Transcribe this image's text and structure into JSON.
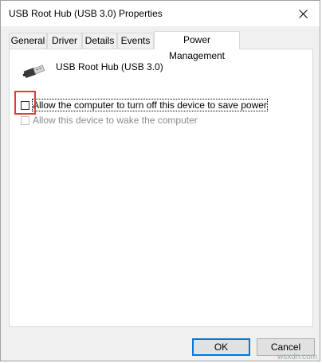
{
  "window": {
    "title": "USB Root Hub (USB 3.0) Properties"
  },
  "tabs": [
    {
      "label": "General"
    },
    {
      "label": "Driver"
    },
    {
      "label": "Details"
    },
    {
      "label": "Events"
    },
    {
      "label": "Power Management",
      "active": true
    }
  ],
  "device": {
    "name": "USB Root Hub (USB 3.0)",
    "icon": "usb-plug-icon"
  },
  "options": [
    {
      "label": "Allow the computer to turn off this device to save power",
      "checked": false,
      "enabled": true
    },
    {
      "label": "Allow this device to wake the computer",
      "checked": false,
      "enabled": false
    }
  ],
  "buttons": {
    "ok": "OK",
    "cancel": "Cancel"
  },
  "highlight_color": "#e13a3a",
  "watermark": "wsxdn.com"
}
